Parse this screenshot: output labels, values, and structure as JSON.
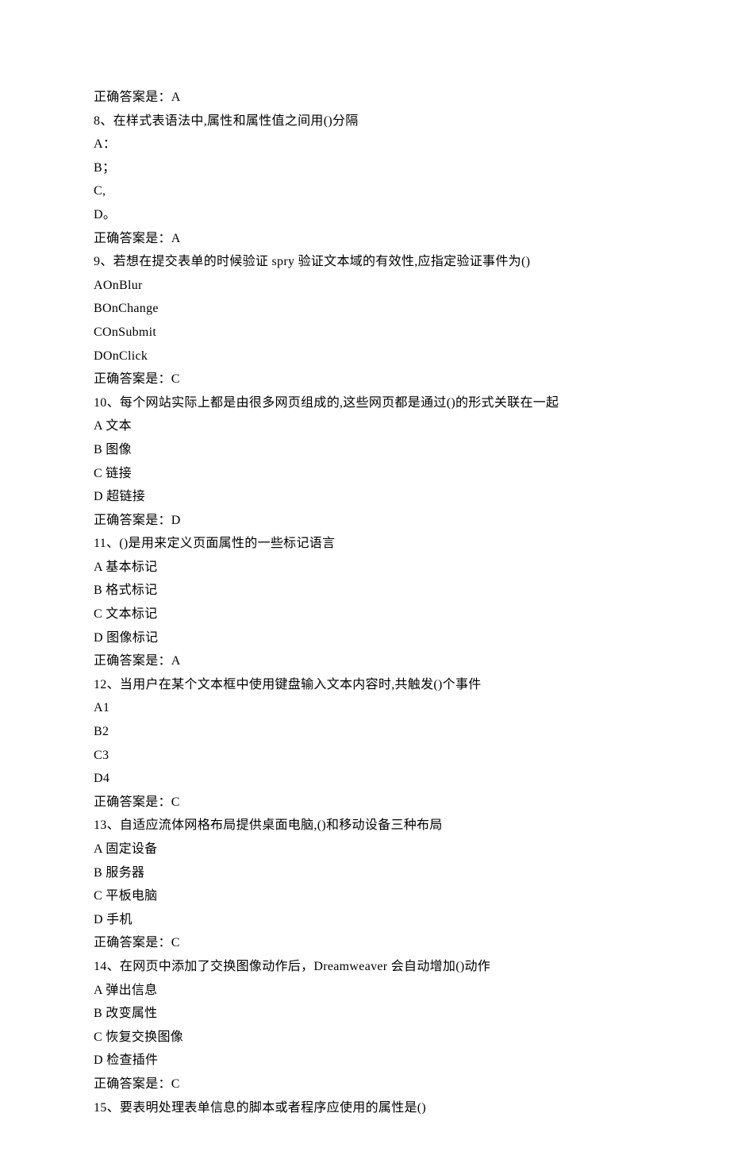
{
  "lines": [
    "正确答案是：A",
    "8、在样式表语法中,属性和属性值之间用()分隔",
    "A：",
    "B；",
    "C,",
    "D。",
    "正确答案是：A",
    "9、若想在提交表单的时候验证 spry 验证文本域的有效性,应指定验证事件为()",
    "AOnBlur",
    "BOnChange",
    "COnSubmit",
    "DOnClick",
    "正确答案是：C",
    "10、每个网站实际上都是由很多网页组成的,这些网页都是通过()的形式关联在一起",
    "A 文本",
    "B 图像",
    "C 链接",
    "D 超链接",
    "正确答案是：D",
    "11、()是用来定义页面属性的一些标记语言",
    "A 基本标记",
    "B 格式标记",
    "C 文本标记",
    "D 图像标记",
    "正确答案是：A",
    "12、当用户在某个文本框中使用键盘输入文本内容时,共触发()个事件",
    "A1",
    "B2",
    "C3",
    "D4",
    "正确答案是：C",
    "13、自适应流体网格布局提供桌面电脑,()和移动设备三种布局",
    "A 固定设备",
    "B 服务器",
    "C 平板电脑",
    "D 手机",
    "正确答案是：C",
    "14、在网页中添加了交换图像动作后，Dreamweaver 会自动增加()动作",
    "A 弹出信息",
    "B 改变属性",
    "C 恢复交换图像",
    "D 检查插件",
    "正确答案是：C",
    "15、要表明处理表单信息的脚本或者程序应使用的属性是()"
  ]
}
